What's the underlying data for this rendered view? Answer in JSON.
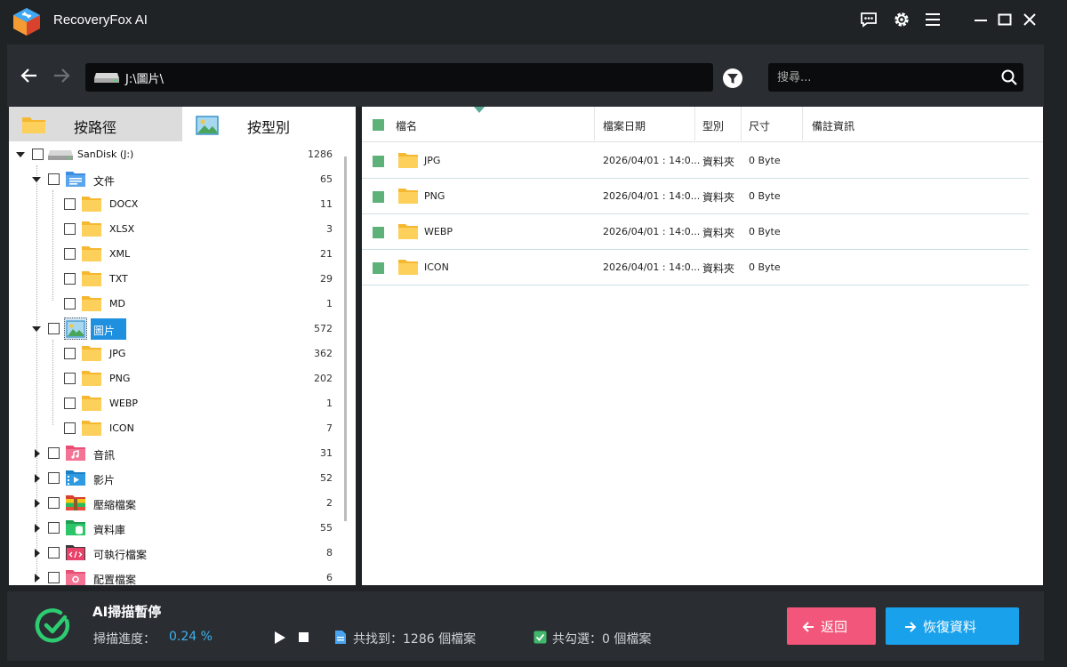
{
  "app": {
    "title": "RecoveryFox AI"
  },
  "nav": {
    "path": "J:\\圖片\\",
    "search_placeholder": "搜尋..."
  },
  "tabs": [
    {
      "label": "按路徑",
      "icon": "folder-icon",
      "active": false
    },
    {
      "label": "按型別",
      "icon": "image-icon",
      "active": true
    }
  ],
  "tree": {
    "drive": {
      "label": "SanDisk (J:)",
      "count": "1286"
    },
    "documents": {
      "label": "文件",
      "count": "65",
      "children": [
        {
          "label": "DOCX",
          "count": "11"
        },
        {
          "label": "XLSX",
          "count": "3"
        },
        {
          "label": "XML",
          "count": "21"
        },
        {
          "label": "TXT",
          "count": "29"
        },
        {
          "label": "MD",
          "count": "1"
        }
      ]
    },
    "pictures": {
      "label": "圖片",
      "count": "572",
      "children": [
        {
          "label": "JPG",
          "count": "362"
        },
        {
          "label": "PNG",
          "count": "202"
        },
        {
          "label": "WEBP",
          "count": "1"
        },
        {
          "label": "ICON",
          "count": "7"
        }
      ]
    },
    "others": [
      {
        "label": "音訊",
        "count": "31",
        "icon": "audio-icon",
        "color": "#f06c8c"
      },
      {
        "label": "影片",
        "count": "52",
        "icon": "video-icon",
        "color": "#1f8fd6"
      },
      {
        "label": "壓縮檔案",
        "count": "2",
        "icon": "archive-icon",
        "color": "#e84c3d"
      },
      {
        "label": "資料庫",
        "count": "55",
        "icon": "database-icon",
        "color": "#28b463"
      },
      {
        "label": "可執行檔案",
        "count": "8",
        "icon": "executable-icon",
        "color": "#e8416a"
      },
      {
        "label": "配置檔案",
        "count": "6",
        "icon": "config-icon",
        "color": "#f06c8c"
      }
    ]
  },
  "table": {
    "columns": [
      "檔名",
      "檔案日期",
      "型別",
      "尺寸",
      "備註資訊"
    ],
    "rows": [
      {
        "name": "JPG",
        "date": "2026/04/01 : 14:0...",
        "type": "資料夾",
        "size": "0 Byte"
      },
      {
        "name": "PNG",
        "date": "2026/04/01 : 14:0...",
        "type": "資料夾",
        "size": "0 Byte"
      },
      {
        "name": "WEBP",
        "date": "2026/04/01 : 14:0...",
        "type": "資料夾",
        "size": "0 Byte"
      },
      {
        "name": "ICON",
        "date": "2026/04/01 : 14:0...",
        "type": "資料夾",
        "size": "0 Byte"
      }
    ]
  },
  "status": {
    "title": "AI掃描暫停",
    "progress_label": "掃描進度：",
    "progress_value": "0.24 %",
    "found": "共找到：1286 個檔案",
    "selected": "共勾選：0 個檔案"
  },
  "buttons": {
    "back": "返回",
    "recover": "恢復資料"
  },
  "colors": {
    "accent_blue": "#19a1ec",
    "back_pink": "#f2567a",
    "status_green": "#2ecc71",
    "check_green": "#5fb17a",
    "folder_yellow": "#f6b731"
  }
}
